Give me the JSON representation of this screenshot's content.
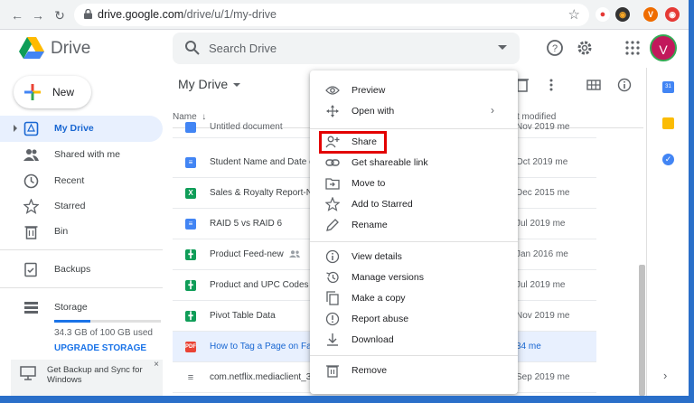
{
  "browser": {
    "url_domain": "drive.google.com",
    "url_path": "/drive/u/1/my-drive",
    "ext1": "•",
    "ext2": "V"
  },
  "header": {
    "brand": "Drive",
    "search_placeholder": "Search Drive",
    "avatar_letter": "V"
  },
  "sidebar": {
    "new_label": "New",
    "items": [
      {
        "label": "My Drive",
        "icon": "my-drive-icon"
      },
      {
        "label": "Shared with me",
        "icon": "people-icon"
      },
      {
        "label": "Recent",
        "icon": "clock-icon"
      },
      {
        "label": "Starred",
        "icon": "star-icon"
      },
      {
        "label": "Bin",
        "icon": "trash-icon"
      },
      {
        "label": "Backups",
        "icon": "backup-icon"
      },
      {
        "label": "Storage",
        "icon": "storage-icon"
      }
    ],
    "storage_used_fraction": 0.343,
    "storage_text": "34.3 GB of 100 GB used",
    "upgrade": "UPGRADE STORAGE",
    "backup_banner": "Get Backup and Sync for Windows",
    "backup_close": "×"
  },
  "main": {
    "title": "My Drive",
    "col_name": "Name",
    "col_sort": "↓",
    "col_modified": "st modified",
    "files": [
      {
        "name": "Untitled document",
        "date": "Nov 2019",
        "owner": "me",
        "type": "doc"
      },
      {
        "name": "Student Name and Date of",
        "date": "Oct 2019",
        "owner": "me",
        "type": "doc"
      },
      {
        "name": "Sales & Royalty Report-Nov",
        "date": "Dec 2015",
        "owner": "me",
        "type": "xls"
      },
      {
        "name": "RAID 5 vs RAID 6",
        "date": "Jul 2019",
        "owner": "me",
        "type": "doc"
      },
      {
        "name": "Product Feed-new",
        "date": "Jan 2016",
        "owner": "me",
        "type": "sheet",
        "shared": true
      },
      {
        "name": "Product and UPC Codes",
        "date": "Jul 2019",
        "owner": "me",
        "type": "sheet"
      },
      {
        "name": "Pivot Table Data",
        "date": "Nov 2019",
        "owner": "me",
        "type": "sheet"
      },
      {
        "name": "How to Tag a Page on Face",
        "date": "34",
        "owner": "me",
        "type": "pdf",
        "selected": true
      },
      {
        "name": "com.netflix.mediaclient_3.",
        "date": "Sep 2019",
        "owner": "me",
        "type": "list"
      }
    ]
  },
  "context_menu": {
    "items": [
      {
        "label": "Preview",
        "icon": "eye-icon"
      },
      {
        "label": "Open with",
        "icon": "move-arrows-icon",
        "submenu": "›"
      },
      {
        "label": "Share",
        "icon": "add-person-icon"
      },
      {
        "label": "Get shareable link",
        "icon": "link-icon"
      },
      {
        "label": "Move to",
        "icon": "folder-move-icon"
      },
      {
        "label": "Add to Starred",
        "icon": "star-outline-icon"
      },
      {
        "label": "Rename",
        "icon": "pencil-icon"
      },
      {
        "label": "View details",
        "icon": "info-icon"
      },
      {
        "label": "Manage versions",
        "icon": "history-icon"
      },
      {
        "label": "Make a copy",
        "icon": "copy-icon"
      },
      {
        "label": "Report abuse",
        "icon": "report-icon"
      },
      {
        "label": "Download",
        "icon": "download-icon"
      },
      {
        "label": "Remove",
        "icon": "trash-icon"
      }
    ]
  },
  "colors": {
    "accent": "#1a73e8",
    "highlight_border": "#e30000",
    "selected_row": "#e8f0fe"
  }
}
